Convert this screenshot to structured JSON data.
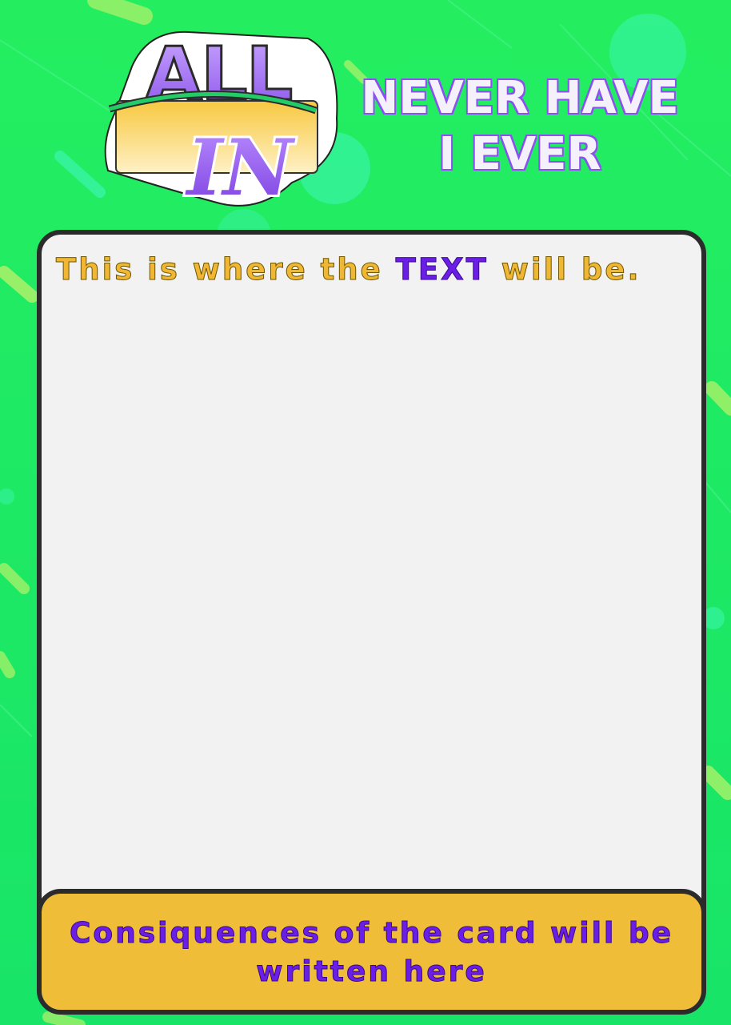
{
  "logo": {
    "top_text": "ALL",
    "bottom_text": "IN"
  },
  "title": {
    "line1": "NEVER HAVE",
    "line2": "I EVER"
  },
  "card": {
    "prompt_before": "This is where the ",
    "prompt_keyword": "TEXT",
    "prompt_after": " will be.",
    "consequence_line1": "Consiquences of the card will be",
    "consequence_line2": "written here"
  },
  "colors": {
    "background": "#1eea62",
    "card_bg": "#f2f2f2",
    "border": "#2b2b2b",
    "accent_yellow": "#efb733",
    "accent_purple": "#6a1ee6",
    "title_fill": "#f4f1fb",
    "title_stroke": "#8b4ff2"
  }
}
